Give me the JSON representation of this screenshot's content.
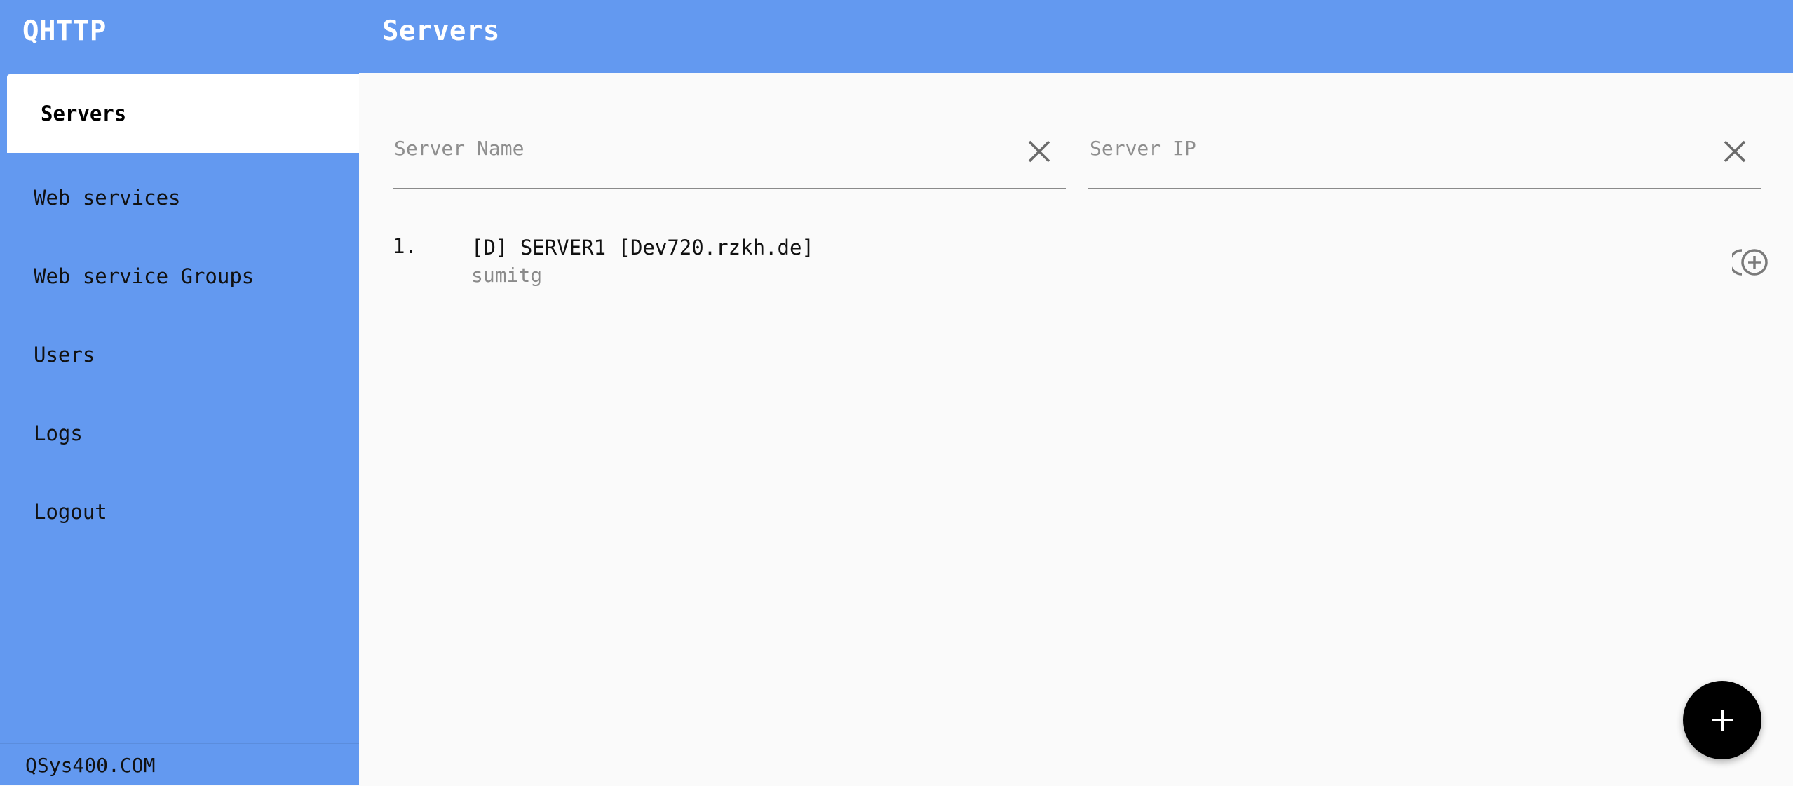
{
  "header": {
    "app_title": "QHTTP",
    "page_title": "Servers"
  },
  "sidebar": {
    "items": [
      {
        "label": "Servers",
        "active": true
      },
      {
        "label": "Web services",
        "active": false
      },
      {
        "label": "Web service Groups",
        "active": false
      },
      {
        "label": "Users",
        "active": false
      },
      {
        "label": "Logs",
        "active": false
      },
      {
        "label": "Logout",
        "active": false
      }
    ],
    "footer": "QSys400.COM"
  },
  "filters": {
    "server_name": {
      "placeholder": "Server Name",
      "value": "",
      "clear_icon": "close-icon"
    },
    "server_ip": {
      "placeholder": "Server IP",
      "value": "",
      "clear_icon": "close-icon"
    }
  },
  "servers": [
    {
      "index": "1.",
      "title": "[D] SERVER1 [Dev720.rzkh.de]",
      "subtitle": "sumitg",
      "action_icon": "add-circle-icon"
    }
  ],
  "fab": {
    "icon": "plus-icon"
  },
  "colors": {
    "primary": "#6399f0",
    "background": "#fafafa",
    "fab": "#000000"
  }
}
